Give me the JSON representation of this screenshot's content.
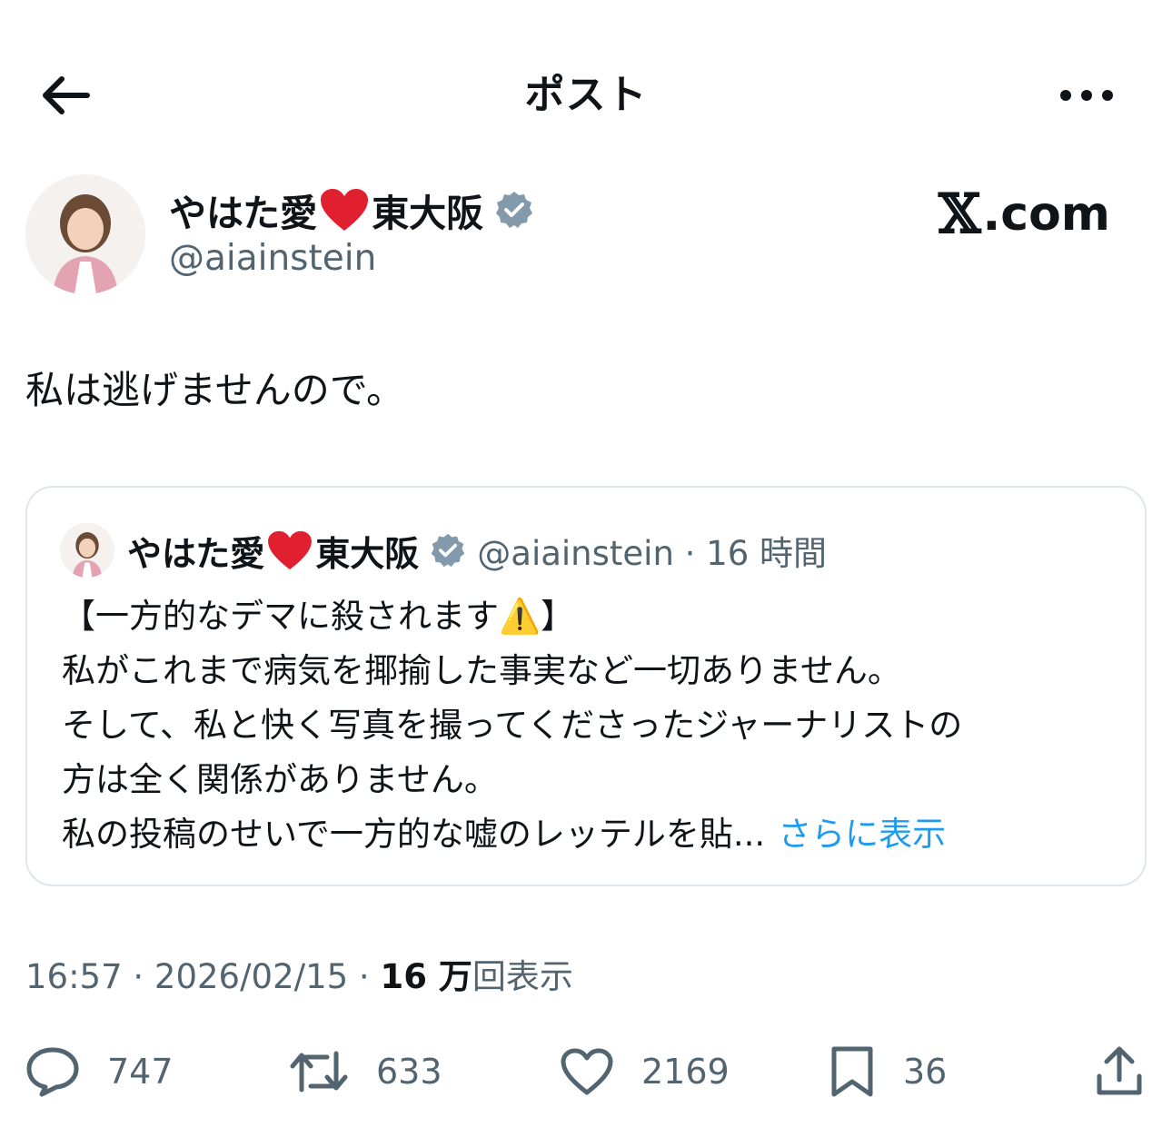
{
  "header": {
    "title": "ポスト",
    "back_icon": "arrow-left-icon",
    "more_icon": "more-horizontal-icon"
  },
  "author": {
    "display_name_prefix": "やはた愛",
    "display_name_suffix": "東大阪",
    "handle": "@aiainstein",
    "verified": true
  },
  "watermark": {
    "x": "𝕏",
    "domain": ".com"
  },
  "post": {
    "text": "私は逃げませんので。"
  },
  "quote": {
    "display_name_prefix": "やはた愛",
    "display_name_suffix": "東大阪",
    "handle_time": "@aiainstein · 16 時間",
    "lines": [
      "【一方的なデマに殺されます⚠️】",
      "私がこれまで病気を揶揄した事実など一切ありません。",
      "そして、私と快く写真を撮ってくださったジャーナリストの",
      "方は全く関係がありません。",
      "私の投稿のせいで一方的な嘘のレッテルを貼..."
    ],
    "show_more": "さらに表示"
  },
  "meta": {
    "time_date": "16:57 · 2026/02/15 · ",
    "views_count": "16 万",
    "views_label": "回表示"
  },
  "actions": {
    "replies": "747",
    "reposts": "633",
    "likes": "2169",
    "bookmarks": "36"
  },
  "colors": {
    "text": "#0f1419",
    "secondary": "#536471",
    "link": "#1d9bf0",
    "border": "#e1e6ea",
    "heart": "#e0202e",
    "verified": "#829aab"
  }
}
